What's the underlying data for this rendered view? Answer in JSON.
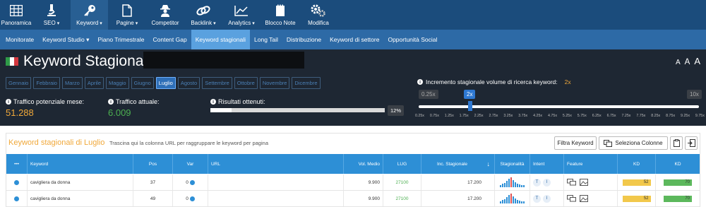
{
  "nav": {
    "items": [
      {
        "label": "Panoramica",
        "icon": "grid-icon",
        "caret": ""
      },
      {
        "label": "SEO",
        "icon": "microscope-icon",
        "caret": "▾"
      },
      {
        "label": "Keyword",
        "icon": "key-icon",
        "caret": "▾"
      },
      {
        "label": "Pagine",
        "icon": "page-icon",
        "caret": "▾"
      },
      {
        "label": "Competitor",
        "icon": "spy-icon",
        "caret": ""
      },
      {
        "label": "Backlink",
        "icon": "link-icon",
        "caret": "▾"
      },
      {
        "label": "Analytics",
        "icon": "line-chart-icon",
        "caret": "▾"
      },
      {
        "label": "Blocco Note",
        "icon": "notepad-icon",
        "caret": ""
      },
      {
        "label": "Modifica",
        "icon": "gears-icon",
        "caret": ""
      }
    ]
  },
  "subnav": {
    "items": [
      "Monitorate",
      "Keyword Studio ▾",
      "Piano Trimestrale",
      "Content Gap",
      "Keyword stagionali",
      "Long Tail",
      "Distribuzione",
      "Keyword di settore",
      "Opportunità Social"
    ]
  },
  "header": {
    "title": "Keyword Stagionali:",
    "font_sizes": [
      "A",
      "A",
      "A"
    ]
  },
  "months": [
    "Gennaio",
    "Febbraio",
    "Marzo",
    "Aprile",
    "Maggio",
    "Giugno",
    "Luglio",
    "Agosto",
    "Settembre",
    "Ottobre",
    "Novembre",
    "Dicembre"
  ],
  "stats": {
    "traffico_potenziale_label": "Traffico potenziale mese:",
    "traffico_potenziale_value": "51.288",
    "traffico_attuale_label": "Traffico attuale:",
    "traffico_attuale_value": "6.009",
    "risultati_label": "Risultati ottenuti:",
    "risultati_pct": "12%",
    "risultati_fraction": 0.12
  },
  "slider": {
    "label": "Incremento stagionale volume di ricerca keyword:",
    "value": "2x",
    "min_badge": "0.25x",
    "max_badge": "10x",
    "ticks": [
      "0.25x",
      "0.75x",
      "1.25x",
      "1.75x",
      "2.25x",
      "2.75x",
      "3.25x",
      "3.75x",
      "4.25x",
      "4.75x",
      "5.25x",
      "5.75x",
      "6.25x",
      "6.75x",
      "7.25x",
      "7.75x",
      "8.25x",
      "8.75x",
      "9.25x",
      "9.75x"
    ]
  },
  "panel": {
    "title": "Keyword stagionali di Luglio",
    "hint": "Trascina qui la colonna URL per raggruppare le keyword per pagina",
    "filter_button": "Filtra Keyword",
    "columns_button": "Seleziona Colonne"
  },
  "table": {
    "headers": {
      "menu": "•••",
      "keyword": "Keyword",
      "pos": "Pos",
      "var": "Var",
      "url": "URL",
      "vol": "Vol. Medio",
      "lug": "LUG",
      "inc": "Inc. Stagionale",
      "sort": "↓",
      "stagionalita": "Stagionalità",
      "intent": "Intent",
      "feature": "Feature",
      "kd": "KD",
      "kd2": "KD"
    },
    "rows": [
      {
        "keyword": "cavigliera da donna",
        "pos": "37",
        "var": "0",
        "url": "",
        "vol": "9.900",
        "lug": "27100",
        "inc": "17.200",
        "intent1": "T",
        "intent2": "I",
        "kd": "52",
        "kd2": "70"
      },
      {
        "keyword": "cavigliera da donna",
        "pos": "49",
        "var": "0",
        "url": "",
        "vol": "9.900",
        "lug": "27100",
        "inc": "17.200",
        "intent1": "T",
        "intent2": "I",
        "kd": "52",
        "kd2": "70"
      }
    ]
  },
  "colors": {
    "nav_bg": "#1b4c7c",
    "subnav_bg": "#2d6aa6",
    "accent": "#2d8fd6",
    "orange": "#f0a83a",
    "green": "#4caf50",
    "kd_yellow": "#f2c84b",
    "kd_green": "#5cb85c"
  }
}
